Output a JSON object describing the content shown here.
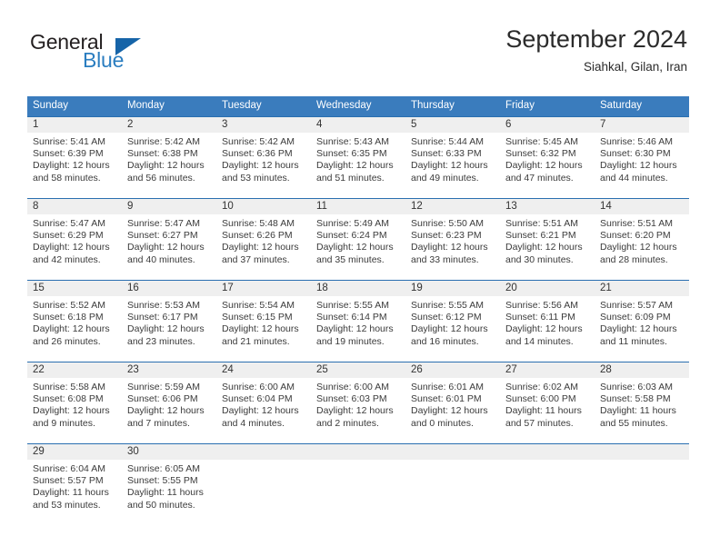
{
  "brand": {
    "name_top": "General",
    "name_bottom": "Blue",
    "triangle_color": "#1664a8",
    "blue_color": "#2a7dc0",
    "dark_color": "#231f20"
  },
  "header": {
    "title": "September 2024",
    "subtitle": "Siahkal, Gilan, Iran"
  },
  "theme": {
    "header_row_bg": "#3a7cbd",
    "row_rule": "#2a6fb0",
    "daynum_band_bg": "#efefef",
    "text": "#3b3b3b"
  },
  "weekday_headers": [
    "Sunday",
    "Monday",
    "Tuesday",
    "Wednesday",
    "Thursday",
    "Friday",
    "Saturday"
  ],
  "weeks": [
    [
      {
        "day": "1",
        "sunrise": "Sunrise: 5:41 AM",
        "sunset": "Sunset: 6:39 PM",
        "daylight_line1": "Daylight: 12 hours",
        "daylight_line2": "and 58 minutes."
      },
      {
        "day": "2",
        "sunrise": "Sunrise: 5:42 AM",
        "sunset": "Sunset: 6:38 PM",
        "daylight_line1": "Daylight: 12 hours",
        "daylight_line2": "and 56 minutes."
      },
      {
        "day": "3",
        "sunrise": "Sunrise: 5:42 AM",
        "sunset": "Sunset: 6:36 PM",
        "daylight_line1": "Daylight: 12 hours",
        "daylight_line2": "and 53 minutes."
      },
      {
        "day": "4",
        "sunrise": "Sunrise: 5:43 AM",
        "sunset": "Sunset: 6:35 PM",
        "daylight_line1": "Daylight: 12 hours",
        "daylight_line2": "and 51 minutes."
      },
      {
        "day": "5",
        "sunrise": "Sunrise: 5:44 AM",
        "sunset": "Sunset: 6:33 PM",
        "daylight_line1": "Daylight: 12 hours",
        "daylight_line2": "and 49 minutes."
      },
      {
        "day": "6",
        "sunrise": "Sunrise: 5:45 AM",
        "sunset": "Sunset: 6:32 PM",
        "daylight_line1": "Daylight: 12 hours",
        "daylight_line2": "and 47 minutes."
      },
      {
        "day": "7",
        "sunrise": "Sunrise: 5:46 AM",
        "sunset": "Sunset: 6:30 PM",
        "daylight_line1": "Daylight: 12 hours",
        "daylight_line2": "and 44 minutes."
      }
    ],
    [
      {
        "day": "8",
        "sunrise": "Sunrise: 5:47 AM",
        "sunset": "Sunset: 6:29 PM",
        "daylight_line1": "Daylight: 12 hours",
        "daylight_line2": "and 42 minutes."
      },
      {
        "day": "9",
        "sunrise": "Sunrise: 5:47 AM",
        "sunset": "Sunset: 6:27 PM",
        "daylight_line1": "Daylight: 12 hours",
        "daylight_line2": "and 40 minutes."
      },
      {
        "day": "10",
        "sunrise": "Sunrise: 5:48 AM",
        "sunset": "Sunset: 6:26 PM",
        "daylight_line1": "Daylight: 12 hours",
        "daylight_line2": "and 37 minutes."
      },
      {
        "day": "11",
        "sunrise": "Sunrise: 5:49 AM",
        "sunset": "Sunset: 6:24 PM",
        "daylight_line1": "Daylight: 12 hours",
        "daylight_line2": "and 35 minutes."
      },
      {
        "day": "12",
        "sunrise": "Sunrise: 5:50 AM",
        "sunset": "Sunset: 6:23 PM",
        "daylight_line1": "Daylight: 12 hours",
        "daylight_line2": "and 33 minutes."
      },
      {
        "day": "13",
        "sunrise": "Sunrise: 5:51 AM",
        "sunset": "Sunset: 6:21 PM",
        "daylight_line1": "Daylight: 12 hours",
        "daylight_line2": "and 30 minutes."
      },
      {
        "day": "14",
        "sunrise": "Sunrise: 5:51 AM",
        "sunset": "Sunset: 6:20 PM",
        "daylight_line1": "Daylight: 12 hours",
        "daylight_line2": "and 28 minutes."
      }
    ],
    [
      {
        "day": "15",
        "sunrise": "Sunrise: 5:52 AM",
        "sunset": "Sunset: 6:18 PM",
        "daylight_line1": "Daylight: 12 hours",
        "daylight_line2": "and 26 minutes."
      },
      {
        "day": "16",
        "sunrise": "Sunrise: 5:53 AM",
        "sunset": "Sunset: 6:17 PM",
        "daylight_line1": "Daylight: 12 hours",
        "daylight_line2": "and 23 minutes."
      },
      {
        "day": "17",
        "sunrise": "Sunrise: 5:54 AM",
        "sunset": "Sunset: 6:15 PM",
        "daylight_line1": "Daylight: 12 hours",
        "daylight_line2": "and 21 minutes."
      },
      {
        "day": "18",
        "sunrise": "Sunrise: 5:55 AM",
        "sunset": "Sunset: 6:14 PM",
        "daylight_line1": "Daylight: 12 hours",
        "daylight_line2": "and 19 minutes."
      },
      {
        "day": "19",
        "sunrise": "Sunrise: 5:55 AM",
        "sunset": "Sunset: 6:12 PM",
        "daylight_line1": "Daylight: 12 hours",
        "daylight_line2": "and 16 minutes."
      },
      {
        "day": "20",
        "sunrise": "Sunrise: 5:56 AM",
        "sunset": "Sunset: 6:11 PM",
        "daylight_line1": "Daylight: 12 hours",
        "daylight_line2": "and 14 minutes."
      },
      {
        "day": "21",
        "sunrise": "Sunrise: 5:57 AM",
        "sunset": "Sunset: 6:09 PM",
        "daylight_line1": "Daylight: 12 hours",
        "daylight_line2": "and 11 minutes."
      }
    ],
    [
      {
        "day": "22",
        "sunrise": "Sunrise: 5:58 AM",
        "sunset": "Sunset: 6:08 PM",
        "daylight_line1": "Daylight: 12 hours",
        "daylight_line2": "and 9 minutes."
      },
      {
        "day": "23",
        "sunrise": "Sunrise: 5:59 AM",
        "sunset": "Sunset: 6:06 PM",
        "daylight_line1": "Daylight: 12 hours",
        "daylight_line2": "and 7 minutes."
      },
      {
        "day": "24",
        "sunrise": "Sunrise: 6:00 AM",
        "sunset": "Sunset: 6:04 PM",
        "daylight_line1": "Daylight: 12 hours",
        "daylight_line2": "and 4 minutes."
      },
      {
        "day": "25",
        "sunrise": "Sunrise: 6:00 AM",
        "sunset": "Sunset: 6:03 PM",
        "daylight_line1": "Daylight: 12 hours",
        "daylight_line2": "and 2 minutes."
      },
      {
        "day": "26",
        "sunrise": "Sunrise: 6:01 AM",
        "sunset": "Sunset: 6:01 PM",
        "daylight_line1": "Daylight: 12 hours",
        "daylight_line2": "and 0 minutes."
      },
      {
        "day": "27",
        "sunrise": "Sunrise: 6:02 AM",
        "sunset": "Sunset: 6:00 PM",
        "daylight_line1": "Daylight: 11 hours",
        "daylight_line2": "and 57 minutes."
      },
      {
        "day": "28",
        "sunrise": "Sunrise: 6:03 AM",
        "sunset": "Sunset: 5:58 PM",
        "daylight_line1": "Daylight: 11 hours",
        "daylight_line2": "and 55 minutes."
      }
    ],
    [
      {
        "day": "29",
        "sunrise": "Sunrise: 6:04 AM",
        "sunset": "Sunset: 5:57 PM",
        "daylight_line1": "Daylight: 11 hours",
        "daylight_line2": "and 53 minutes."
      },
      {
        "day": "30",
        "sunrise": "Sunrise: 6:05 AM",
        "sunset": "Sunset: 5:55 PM",
        "daylight_line1": "Daylight: 11 hours",
        "daylight_line2": "and 50 minutes."
      },
      {
        "day": "",
        "sunrise": "",
        "sunset": "",
        "daylight_line1": "",
        "daylight_line2": ""
      },
      {
        "day": "",
        "sunrise": "",
        "sunset": "",
        "daylight_line1": "",
        "daylight_line2": ""
      },
      {
        "day": "",
        "sunrise": "",
        "sunset": "",
        "daylight_line1": "",
        "daylight_line2": ""
      },
      {
        "day": "",
        "sunrise": "",
        "sunset": "",
        "daylight_line1": "",
        "daylight_line2": ""
      },
      {
        "day": "",
        "sunrise": "",
        "sunset": "",
        "daylight_line1": "",
        "daylight_line2": ""
      }
    ]
  ]
}
